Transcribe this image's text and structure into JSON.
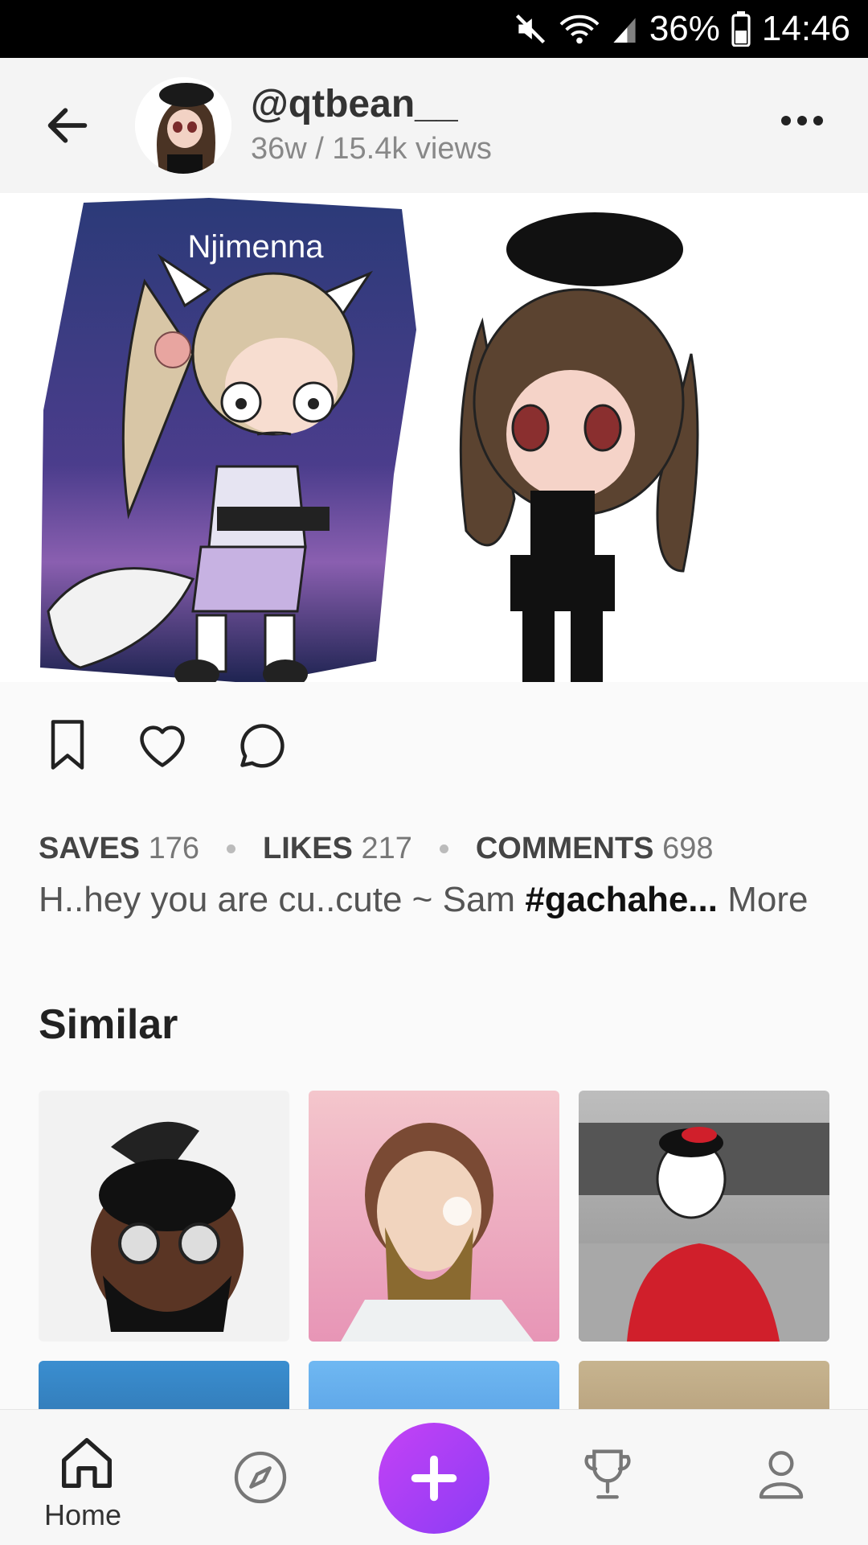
{
  "status_bar": {
    "battery": "36%",
    "time": "14:46"
  },
  "post": {
    "username": "@qtbean__",
    "meta": "36w / 15.4k views",
    "image_label": "Njimenna",
    "stats": {
      "saves_label": "SAVES",
      "saves": "176",
      "likes_label": "LIKES",
      "likes": "217",
      "comments_label": "COMMENTS",
      "comments": "698"
    },
    "caption_text": "H..hey you are cu..cute ~ Sam ",
    "caption_tag": "#gachahe...",
    "caption_more": "More"
  },
  "similar": {
    "title": "Similar"
  },
  "bottom_nav": {
    "home_label": "Home"
  },
  "colors": {
    "fab_gradient_start": "#c542f5",
    "fab_gradient_end": "#8b3cf5",
    "status_bar": "#000000"
  },
  "icons": [
    "mute-icon",
    "wifi-icon",
    "signal-icon",
    "battery-icon",
    "back-arrow-icon",
    "more-dots-icon",
    "bookmark-icon",
    "heart-icon",
    "comment-icon",
    "home-icon",
    "compass-icon",
    "plus-icon",
    "trophy-icon",
    "profile-icon"
  ]
}
